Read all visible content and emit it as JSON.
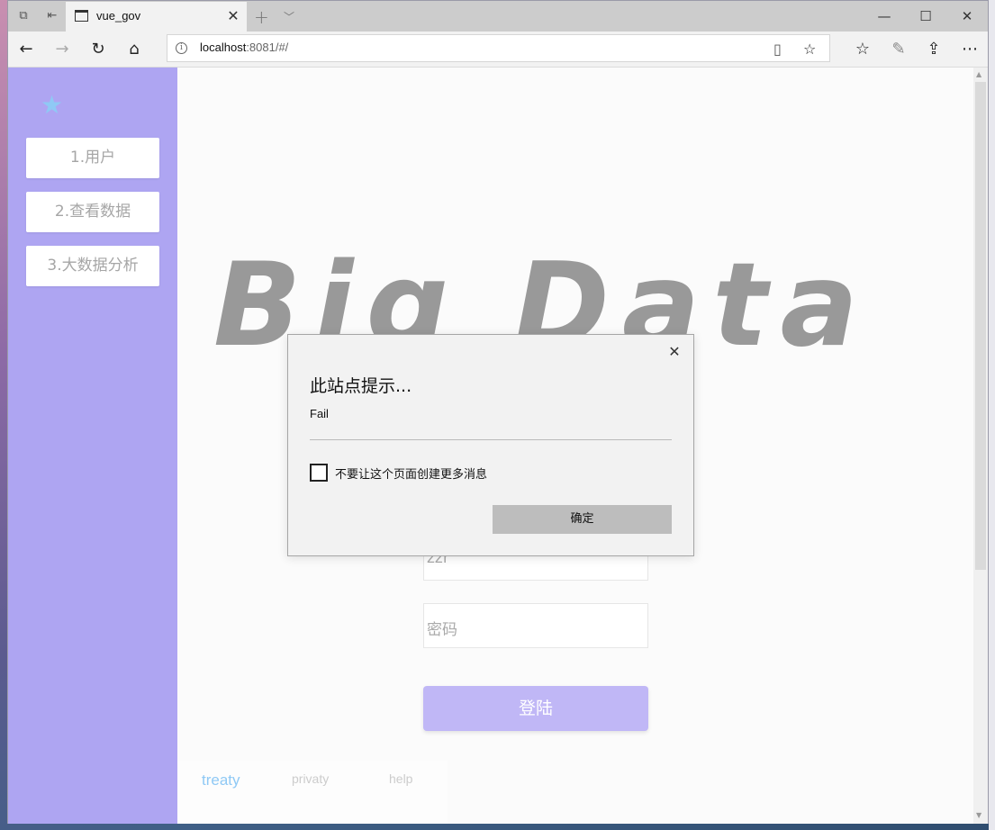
{
  "browser": {
    "tab_title": "vue_gov",
    "address_host": "localhost",
    "address_rest": ":8081/#/",
    "icons": {
      "tab_actions": "tab-set-aside-icon",
      "back": "back-arrow-icon",
      "forward": "forward-arrow-icon",
      "refresh": "refresh-icon",
      "home": "home-icon",
      "reading": "reading-view-icon",
      "favorite": "star-icon",
      "favorites_hub": "favorites-icon",
      "notes": "pen-icon",
      "share": "share-icon",
      "more": "more-icon"
    }
  },
  "sidebar": {
    "logo_icon": "star-icon",
    "items": [
      {
        "label": "1.用户"
      },
      {
        "label": "2.查看数据"
      },
      {
        "label": "3.大数据分析"
      }
    ]
  },
  "main": {
    "hero_text": "Big Data",
    "username_value": "zzr",
    "password_placeholder": "密码",
    "login_label": "登陆",
    "footer_links": [
      {
        "label": "treaty",
        "color": "#8fc9f5"
      },
      {
        "label": "privaty",
        "color": "#cccccc"
      },
      {
        "label": "help",
        "color": "#cccccc"
      }
    ]
  },
  "dialog": {
    "title": "此站点提示...",
    "message": "Fail",
    "checkbox_label": "不要让这个页面创建更多消息",
    "ok_label": "确定"
  },
  "colors": {
    "sidebar_bg": "#aea5f2",
    "accent_star": "#8fc9f5",
    "login_button": "#c0b7f6"
  }
}
